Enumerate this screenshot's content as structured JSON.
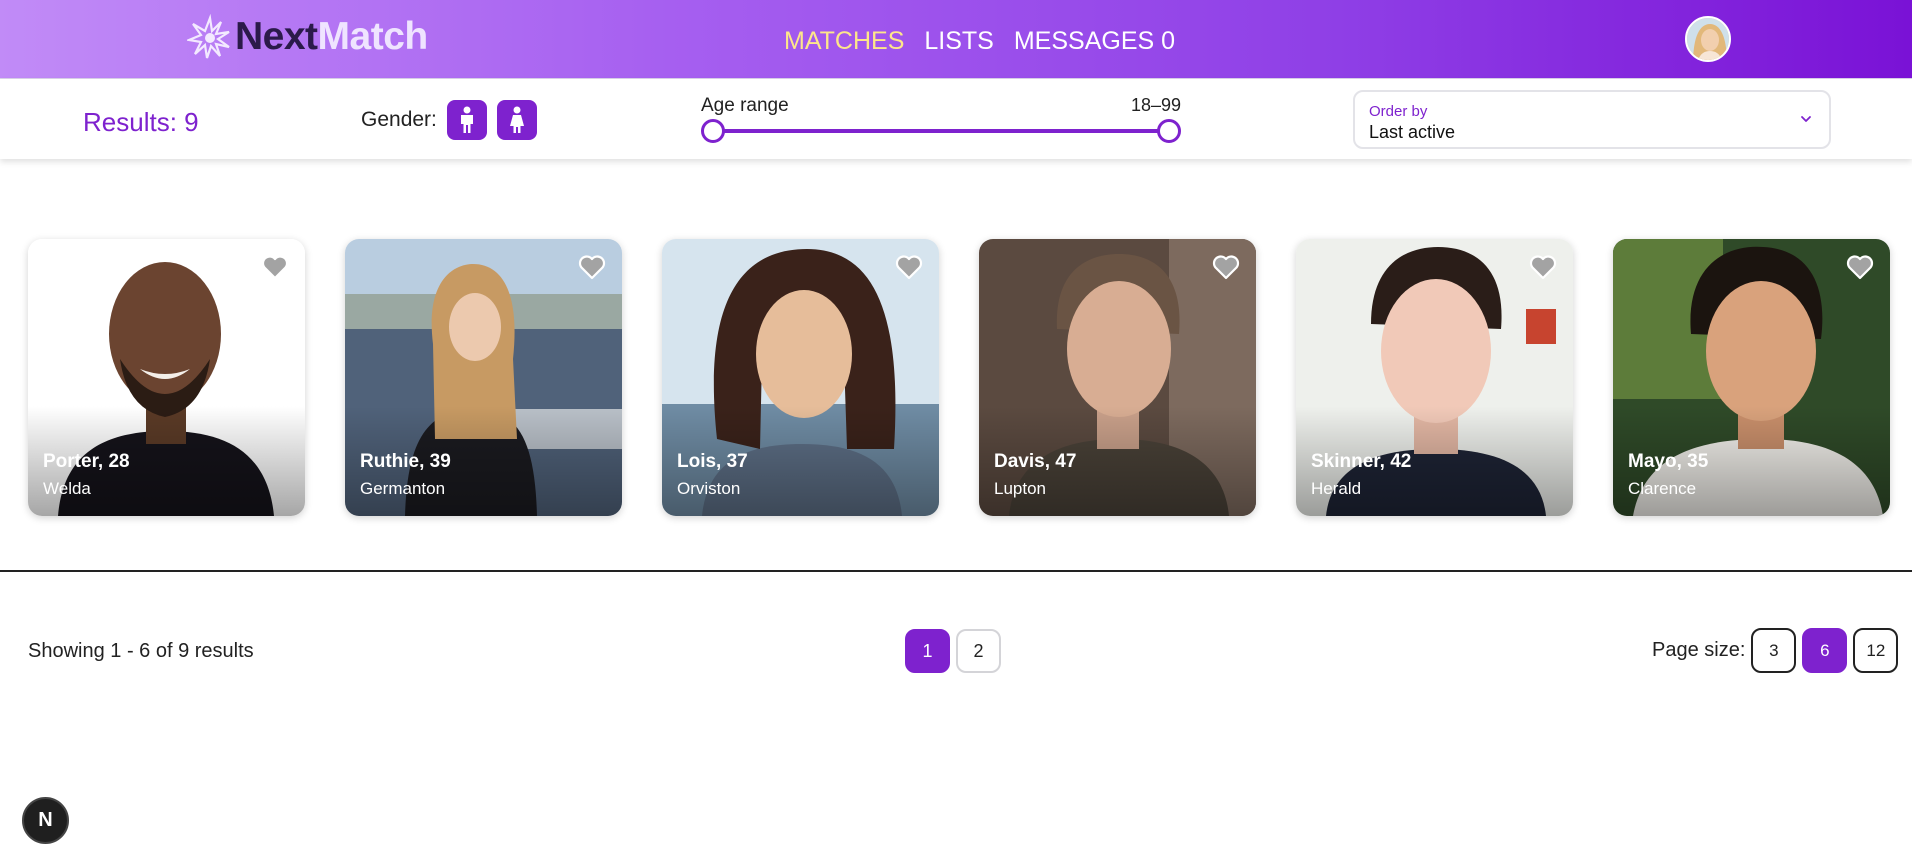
{
  "brand": {
    "name_part1": "Next",
    "name_part2": "Match",
    "accent": "#7e22ce"
  },
  "nav": {
    "items": [
      {
        "label": "MATCHES",
        "active": true
      },
      {
        "label": "LISTS",
        "active": false
      },
      {
        "label": "MESSAGES 0",
        "active": false
      }
    ]
  },
  "filters": {
    "results_text": "Results: 9",
    "gender_label": "Gender:",
    "gender_options": [
      "male-icon",
      "female-icon"
    ],
    "age_label": "Age range",
    "age_value": "18–99",
    "age_min": 18,
    "age_max": 99,
    "order_by_label": "Order by",
    "order_by_value": "Last active"
  },
  "members": [
    {
      "name": "Porter, 28",
      "city": "Welda"
    },
    {
      "name": "Ruthie, 39",
      "city": "Germanton"
    },
    {
      "name": "Lois, 37",
      "city": "Orviston"
    },
    {
      "name": "Davis, 47",
      "city": "Lupton"
    },
    {
      "name": "Skinner, 42",
      "city": "Herald"
    },
    {
      "name": "Mayo, 35",
      "city": "Clarence"
    }
  ],
  "pagination": {
    "showing_text": "Showing 1 - 6 of 9 results",
    "pages": [
      "1",
      "2"
    ],
    "current_page": "1",
    "page_size_label": "Page size:",
    "page_sizes": [
      "3",
      "6",
      "12"
    ],
    "current_page_size": "6"
  },
  "devtools_badge": "N"
}
